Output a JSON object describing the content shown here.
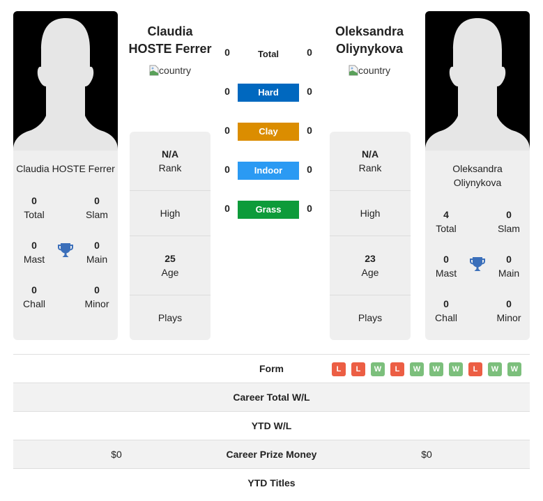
{
  "player1": {
    "name_header": "Claudia HOSTE Ferrer",
    "name_line1": "Claudia",
    "name_line2": "HOSTE Ferrer",
    "country_alt": "country",
    "card_name": "Claudia HOSTE Ferrer",
    "titles": {
      "total": {
        "value": "0",
        "label": "Total"
      },
      "slam": {
        "value": "0",
        "label": "Slam"
      },
      "mast": {
        "value": "0",
        "label": "Mast"
      },
      "main": {
        "value": "0",
        "label": "Main"
      },
      "chall": {
        "value": "0",
        "label": "Chall"
      },
      "minor": {
        "value": "0",
        "label": "Minor"
      }
    },
    "info": {
      "rank": {
        "value": "N/A",
        "label": "Rank"
      },
      "high": {
        "value": "",
        "label": "High"
      },
      "age": {
        "value": "25",
        "label": "Age"
      },
      "plays": {
        "value": "",
        "label": "Plays"
      }
    }
  },
  "player2": {
    "name_line1": "Oleksandra",
    "name_line2": "Oliynykova",
    "country_alt": "country",
    "card_name_line1": "Oleksandra",
    "card_name_line2": "Oliynykova",
    "titles": {
      "total": {
        "value": "4",
        "label": "Total"
      },
      "slam": {
        "value": "0",
        "label": "Slam"
      },
      "mast": {
        "value": "0",
        "label": "Mast"
      },
      "main": {
        "value": "0",
        "label": "Main"
      },
      "chall": {
        "value": "0",
        "label": "Chall"
      },
      "minor": {
        "value": "0",
        "label": "Minor"
      }
    },
    "info": {
      "rank": {
        "value": "N/A",
        "label": "Rank"
      },
      "high": {
        "value": "",
        "label": "High"
      },
      "age": {
        "value": "23",
        "label": "Age"
      },
      "plays": {
        "value": "",
        "label": "Plays"
      }
    }
  },
  "h2h": {
    "total": {
      "label": "Total",
      "p1": "0",
      "p2": "0"
    },
    "surfaces": [
      {
        "label": "Hard",
        "p1": "0",
        "p2": "0",
        "color": "#0068bf"
      },
      {
        "label": "Clay",
        "p1": "0",
        "p2": "0",
        "color": "#db8d00"
      },
      {
        "label": "Indoor",
        "p1": "0",
        "p2": "0",
        "color": "#2b9af3"
      },
      {
        "label": "Grass",
        "p1": "0",
        "p2": "0",
        "color": "#0d9b3a"
      }
    ]
  },
  "comparison": {
    "form": {
      "label": "Form",
      "p2_results": [
        "L",
        "L",
        "W",
        "L",
        "W",
        "W",
        "W",
        "L",
        "W",
        "W"
      ]
    },
    "career_wl": {
      "label": "Career Total W/L",
      "p1": "",
      "p2": ""
    },
    "ytd_wl": {
      "label": "YTD W/L",
      "p1": "",
      "p2": ""
    },
    "prize": {
      "label": "Career Prize Money",
      "p1": "$0",
      "p2": "$0"
    },
    "ytd_titles": {
      "label": "YTD Titles",
      "p1": "",
      "p2": ""
    }
  },
  "colors": {
    "win": "#7cbf7c",
    "loss": "#ec5e44",
    "trophy": "#3b6fba",
    "card_bg": "#efefef"
  }
}
